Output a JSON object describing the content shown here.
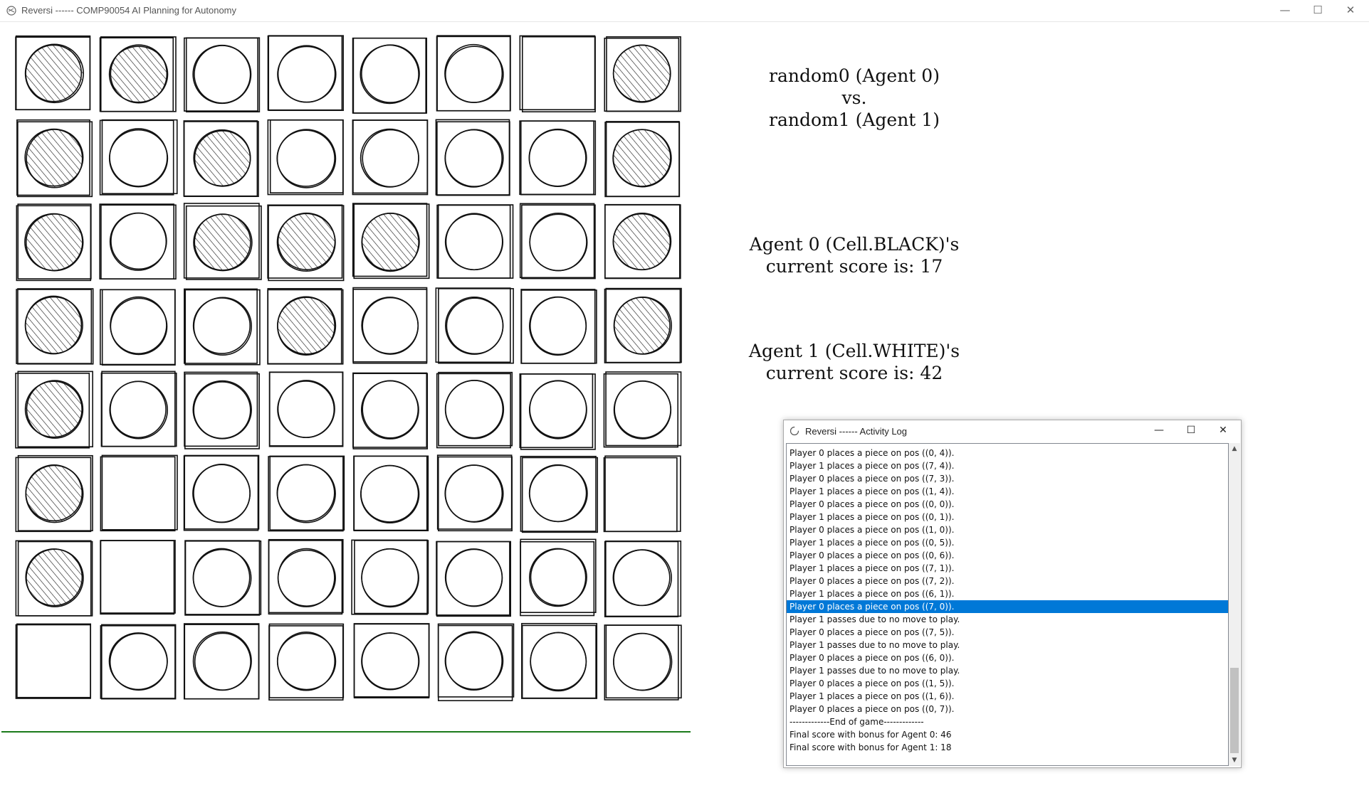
{
  "window": {
    "title": "Reversi ------ COMP90054 AI Planning for Autonomy",
    "minimize_icon": "minimize-icon",
    "maximize_icon": "maximize-icon",
    "close_icon": "close-icon",
    "minimize_glyph": "—",
    "maximize_glyph": "☐",
    "close_glyph": "✕"
  },
  "board": {
    "size": 8,
    "cells": [
      [
        "B",
        "B",
        "W",
        "W",
        "W",
        "W",
        "E",
        "B"
      ],
      [
        "B",
        "W",
        "B",
        "W",
        "W",
        "W",
        "W",
        "B"
      ],
      [
        "B",
        "W",
        "B",
        "B",
        "B",
        "W",
        "W",
        "B"
      ],
      [
        "B",
        "W",
        "W",
        "B",
        "W",
        "W",
        "W",
        "B"
      ],
      [
        "B",
        "W",
        "W",
        "W",
        "W",
        "W",
        "W",
        "W"
      ],
      [
        "B",
        "E",
        "W",
        "W",
        "W",
        "W",
        "W",
        "E"
      ],
      [
        "B",
        "E",
        "W",
        "W",
        "W",
        "W",
        "W",
        "W"
      ],
      [
        "E",
        "W",
        "W",
        "W",
        "W",
        "W",
        "W",
        "W"
      ]
    ],
    "legend": {
      "B": "black-piece",
      "W": "white-piece",
      "E": "empty"
    },
    "colors": {
      "line": "#111111",
      "hatch": "#222222",
      "bottom_line": "#1a7a1a"
    }
  },
  "info": {
    "matchup_line1": "random0 (Agent 0)",
    "matchup_line2": "vs.",
    "matchup_line3": "random1 (Agent 1)",
    "agent0_line1": "Agent 0 (Cell.BLACK)'s",
    "agent0_line2": "current score is: 17",
    "agent1_line1": "Agent 1 (Cell.WHITE)'s",
    "agent1_line2": "current score is: 42"
  },
  "log_window": {
    "title": "Reversi ------ Activity Log",
    "selected_index": 12,
    "selection_color": "#0078d7",
    "scroll_up_glyph": "▲",
    "scroll_down_glyph": "▼",
    "lines": [
      "Player 0 places a piece on pos ((0, 4)).",
      "Player 1 places a piece on pos ((7, 4)).",
      "Player 0 places a piece on pos ((7, 3)).",
      "Player 1 places a piece on pos ((1, 4)).",
      "Player 0 places a piece on pos ((0, 0)).",
      "Player 1 places a piece on pos ((0, 1)).",
      "Player 0 places a piece on pos ((1, 0)).",
      "Player 1 places a piece on pos ((0, 5)).",
      "Player 0 places a piece on pos ((0, 6)).",
      "Player 1 places a piece on pos ((7, 1)).",
      "Player 0 places a piece on pos ((7, 2)).",
      "Player 1 places a piece on pos ((6, 1)).",
      "Player 0 places a piece on pos ((7, 0)).",
      "Player 1 passes due to no move to play.",
      "Player 0 places a piece on pos ((7, 5)).",
      "Player 1 passes due to no move to play.",
      "Player 0 places a piece on pos ((6, 0)).",
      "Player 1 passes due to no move to play.",
      "Player 0 places a piece on pos ((1, 5)).",
      "Player 1 places a piece on pos ((1, 6)).",
      "Player 0 places a piece on pos ((0, 7)).",
      "-------------End of game-------------",
      "Final score with bonus for Agent 0: 46",
      "Final score with bonus for Agent 1: 18"
    ]
  }
}
